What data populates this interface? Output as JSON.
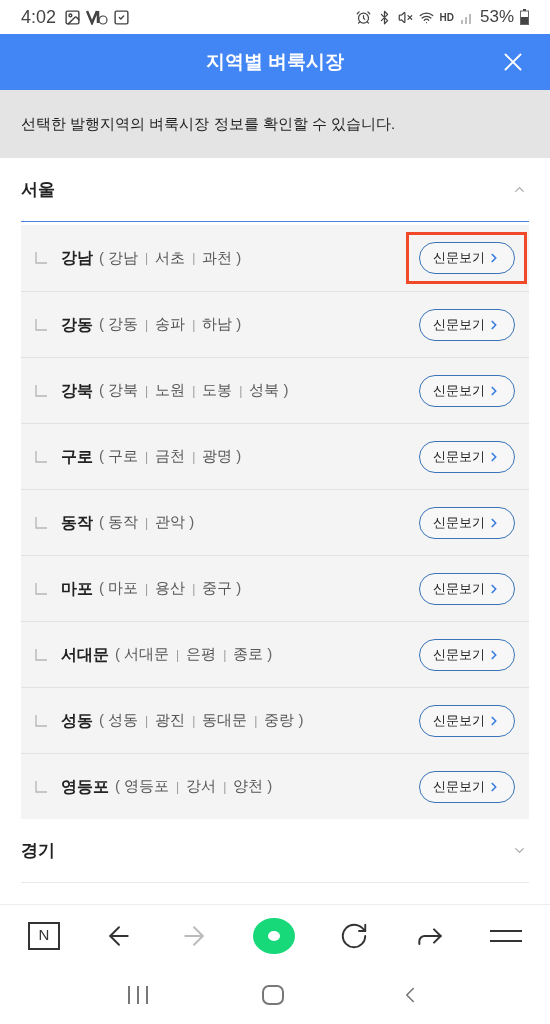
{
  "status_bar": {
    "time": "4:02",
    "hd": "HD",
    "battery": "53%"
  },
  "header": {
    "title": "지역별 벼룩시장"
  },
  "notice": "선택한 발행지역의 벼룩시장 정보를 확인할 수 있습니다.",
  "brackets": [
    "(",
    ")"
  ],
  "separator": "|",
  "sections": [
    {
      "title": "서울",
      "expanded": true,
      "items": [
        {
          "name": "강남",
          "districts": [
            "강남",
            "서초",
            "과천"
          ],
          "button": "신문보기",
          "highlighted": true
        },
        {
          "name": "강동",
          "districts": [
            "강동",
            "송파",
            "하남"
          ],
          "button": "신문보기",
          "highlighted": false
        },
        {
          "name": "강북",
          "districts": [
            "강북",
            "노원",
            "도봉",
            "성북"
          ],
          "button": "신문보기",
          "highlighted": false
        },
        {
          "name": "구로",
          "districts": [
            "구로",
            "금천",
            "광명"
          ],
          "button": "신문보기",
          "highlighted": false
        },
        {
          "name": "동작",
          "districts": [
            "동작",
            "관악"
          ],
          "button": "신문보기",
          "highlighted": false
        },
        {
          "name": "마포",
          "districts": [
            "마포",
            "용산",
            "중구"
          ],
          "button": "신문보기",
          "highlighted": false
        },
        {
          "name": "서대문",
          "districts": [
            "서대문",
            "은평",
            "종로"
          ],
          "button": "신문보기",
          "highlighted": false
        },
        {
          "name": "성동",
          "districts": [
            "성동",
            "광진",
            "동대문",
            "중랑"
          ],
          "button": "신문보기",
          "highlighted": false
        },
        {
          "name": "영등포",
          "districts": [
            "영등포",
            "강서",
            "양천"
          ],
          "button": "신문보기",
          "highlighted": false
        }
      ]
    },
    {
      "title": "경기",
      "expanded": false
    }
  ],
  "browser_bar": {
    "home_letter": "N"
  }
}
